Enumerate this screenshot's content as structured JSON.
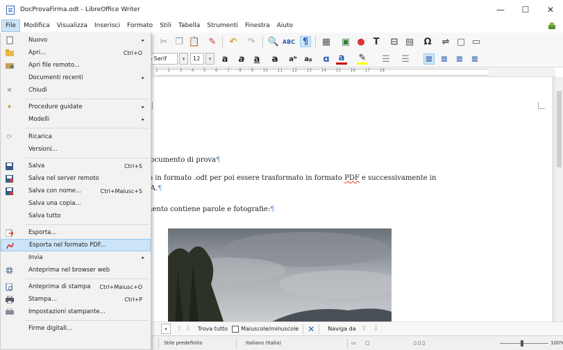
{
  "window": {
    "title": "DocProvaFirma.odt - LibreOffice Writer",
    "minimize": "—",
    "maximize": "☐",
    "close": "✕"
  },
  "menubar": {
    "items": [
      "File",
      "Modifica",
      "Visualizza",
      "Inserisci",
      "Formato",
      "Stili",
      "Tabella",
      "Strumenti",
      "Finestra",
      "Aiuto"
    ]
  },
  "toolbar": {
    "font_name": "n Serif",
    "font_size": "12"
  },
  "ruler": {
    "numbers": "1 · · · 2 · · · 3 · · · 4 · · · 5 · · · 6 · · · 7 · · · 8 · · · 9 · · · 10 · · · 11 · · · 12 · · · 13 · · · 14 · · · 15 · · · 16 · · · 17 · · · 18"
  },
  "document": {
    "line1": "documento di prova",
    "line2a": "to in formato .odt per poi essere trasformato in formato ",
    "line2b": "PDF",
    "line2c": " e successivamente in",
    "line3": "VA.",
    "line4": "mento contiene parole e fotografie:",
    "pilcrow": "¶"
  },
  "file_menu": {
    "items": [
      {
        "label": "Nuovo",
        "shortcut": "",
        "arrow": true,
        "icon": "new-doc-icon"
      },
      {
        "label": "Apri...",
        "shortcut": "Ctrl+O",
        "arrow": false,
        "icon": "open-folder-icon"
      },
      {
        "label": "Apri file remoto...",
        "shortcut": "",
        "arrow": false,
        "icon": "remote-folder-icon"
      },
      {
        "label": "Documenti recenti",
        "shortcut": "",
        "arrow": true,
        "icon": ""
      },
      {
        "label": "Chiudi",
        "shortcut": "",
        "arrow": false,
        "icon": "close-x-icon"
      },
      {
        "label": "Procedure guidate",
        "shortcut": "",
        "arrow": true,
        "icon": "wizard-icon"
      },
      {
        "label": "Modelli",
        "shortcut": "",
        "arrow": true,
        "icon": ""
      },
      {
        "label": "Ricarica",
        "shortcut": "",
        "arrow": false,
        "icon": "reload-icon"
      },
      {
        "label": "Versioni...",
        "shortcut": "",
        "arrow": false,
        "icon": ""
      },
      {
        "label": "Salva",
        "shortcut": "Ctrl+S",
        "arrow": false,
        "icon": "save-icon"
      },
      {
        "label": "Salva nel server remoto",
        "shortcut": "",
        "arrow": false,
        "icon": "save-remote-icon"
      },
      {
        "label": "Salva con nome...",
        "shortcut": "Ctrl+Maiusc+S",
        "arrow": false,
        "icon": "save-as-icon"
      },
      {
        "label": "Salva una copia...",
        "shortcut": "",
        "arrow": false,
        "icon": ""
      },
      {
        "label": "Salva tutto",
        "shortcut": "",
        "arrow": false,
        "icon": ""
      },
      {
        "label": "Esporta...",
        "shortcut": "",
        "arrow": false,
        "icon": "export-icon"
      },
      {
        "label": "Esporta nel formato PDF...",
        "shortcut": "",
        "arrow": false,
        "icon": "export-pdf-icon"
      },
      {
        "label": "Invia",
        "shortcut": "",
        "arrow": true,
        "icon": ""
      },
      {
        "label": "Anteprima nel browser web",
        "shortcut": "",
        "arrow": false,
        "icon": "web-preview-icon"
      },
      {
        "label": "Anteprima di stampa",
        "shortcut": "Ctrl+Maiusc+O",
        "arrow": false,
        "icon": "print-preview-icon"
      },
      {
        "label": "Stampa...",
        "shortcut": "Ctrl+P",
        "arrow": false,
        "icon": "print-icon"
      },
      {
        "label": "Impostazioni stampante...",
        "shortcut": "",
        "arrow": false,
        "icon": "printer-settings-icon"
      },
      {
        "label": "Firme digitali...",
        "shortcut": "",
        "arrow": false,
        "icon": ""
      }
    ]
  },
  "findbar": {
    "find_all": "Trova tutto",
    "match_case": "Maiuscole/minuscole",
    "navigate": "Naviga da"
  },
  "statusbar": {
    "style": "Stile predefinito",
    "language": "Italiano (Italia)",
    "zoom": "100%"
  },
  "colors": {
    "accent": "#cce4f7",
    "accent_border": "#99c9ef",
    "pilcrow": "#6a9ad6"
  }
}
